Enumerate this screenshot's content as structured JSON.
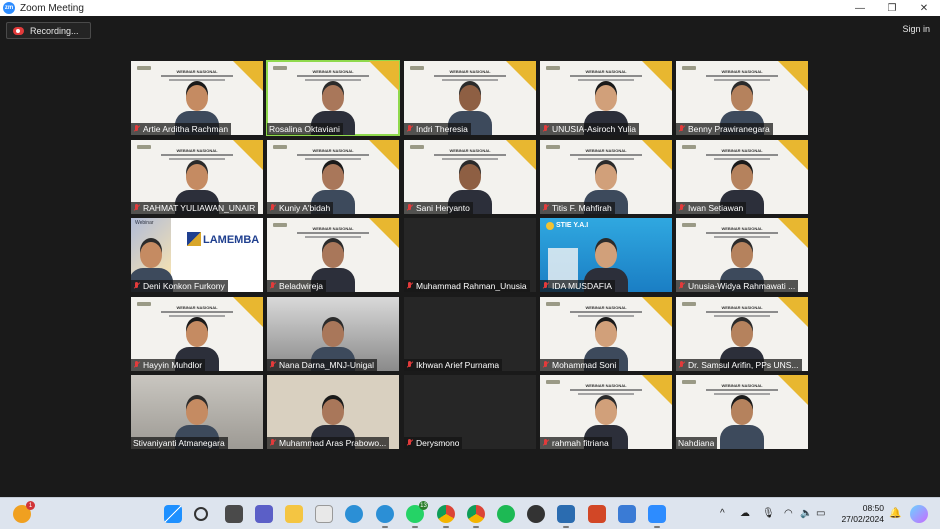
{
  "window": {
    "title": "Zoom Meeting",
    "logo_text": "zm"
  },
  "toolbar": {
    "recording_label": "Recording...",
    "sign_in_label": "Sign in"
  },
  "slide": {
    "title": "WEBINAR NASIONAL"
  },
  "participants": [
    {
      "name": "Artie Arditha Rachman",
      "bg": "slide",
      "muted": true
    },
    {
      "name": "Rosalina Oktaviani",
      "bg": "slide",
      "muted": false,
      "active": true
    },
    {
      "name": "Indri Theresia",
      "bg": "slide",
      "muted": true
    },
    {
      "name": "UNUSIA-Asiroch Yulia",
      "bg": "slide",
      "muted": true
    },
    {
      "name": "Benny Prawiranegara",
      "bg": "slide",
      "muted": true
    },
    {
      "name": "RAHMAT YULIAWAN_UNAIR",
      "bg": "slide",
      "muted": true
    },
    {
      "name": "Kuniy A'bidah",
      "bg": "slide",
      "muted": true
    },
    {
      "name": "Sani Heryanto",
      "bg": "slide",
      "muted": true
    },
    {
      "name": "Titis F. Mahfirah",
      "bg": "slide",
      "muted": true
    },
    {
      "name": "Iwan Setiawan",
      "bg": "slide",
      "muted": true
    },
    {
      "name": "Deni Konkon Furkony",
      "bg": "lamemba",
      "muted": true
    },
    {
      "name": "Beladwireja",
      "bg": "slide",
      "muted": true
    },
    {
      "name": "Muhammad Rahman_Unusia",
      "bg": "dark",
      "muted": true
    },
    {
      "name": "IDA MUSDAFIA",
      "bg": "stie",
      "muted": true
    },
    {
      "name": "Unusia-Widya Rahmawati ...",
      "bg": "slide",
      "muted": true
    },
    {
      "name": "Hayyin Muhdlor",
      "bg": "slide",
      "muted": true
    },
    {
      "name": "Nana Darna_MNJ-Unigal",
      "bg": "room",
      "muted": true
    },
    {
      "name": "Ikhwan Arief Purnama",
      "bg": "dark",
      "muted": true
    },
    {
      "name": "Mohammad Soni",
      "bg": "slide",
      "muted": true
    },
    {
      "name": "Dr. Samsul Arifin, PPs UNS...",
      "bg": "slide",
      "muted": true
    },
    {
      "name": "Stivaniyanti Atmanegara",
      "bg": "office",
      "muted": false
    },
    {
      "name": "Muhammad Aras Prabowo...",
      "bg": "wall",
      "muted": true
    },
    {
      "name": "Derysmono",
      "bg": "dark",
      "muted": true
    },
    {
      "name": "rahmah fitriana",
      "bg": "slide",
      "muted": true
    },
    {
      "name": "Nahdiana",
      "bg": "slide",
      "muted": false
    }
  ],
  "lamemba": {
    "brand": "LAMEMBA",
    "tagline": "Webinar"
  },
  "stie": {
    "brand": "STIE Y.A.I"
  },
  "taskbar": {
    "time": "08:50",
    "date": "27/02/2024",
    "whatsapp_badge": "13",
    "weather_badge": "1",
    "colors": {
      "background": "#dde4ee",
      "accent": "#2d8cff"
    }
  }
}
